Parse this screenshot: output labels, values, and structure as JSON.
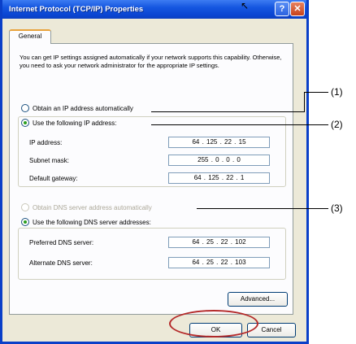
{
  "window": {
    "title": "Internet Protocol (TCP/IP) Properties",
    "help_glyph": "?",
    "close_glyph": "✕"
  },
  "tab": {
    "label": "General"
  },
  "intro_text": "You can get IP settings assigned automatically if your network supports this capability. Otherwise, you need to ask your network administrator for the appropriate IP settings.",
  "ip_section": {
    "auto_label": "Obtain an IP address automatically",
    "manual_label": "Use the following IP address:",
    "ip_label": "IP address:",
    "ip_value": "64 . 125 . 22 . 15",
    "mask_label": "Subnet mask:",
    "mask_value": "255 . 0 . 0 . 0",
    "gateway_label": "Default gateway:",
    "gateway_value": "64 . 125 . 22 . 1"
  },
  "dns_section": {
    "auto_label": "Obtain DNS server address automatically",
    "manual_label": "Use the following DNS server addresses:",
    "preferred_label": "Preferred DNS server:",
    "preferred_value": "64 . 25 . 22 . 102",
    "alternate_label": "Alternate DNS server:",
    "alternate_value": "64 . 25 . 22 . 103"
  },
  "buttons": {
    "advanced": "Advanced...",
    "ok": "OK",
    "cancel": "Cancel"
  },
  "callouts": [
    "(1)",
    "(2)",
    "(3)"
  ],
  "colors": {
    "title_bar": "#0a45d2",
    "highlight_ellipse": "#b42a2a",
    "selected_radio": "#2a9e1e"
  }
}
